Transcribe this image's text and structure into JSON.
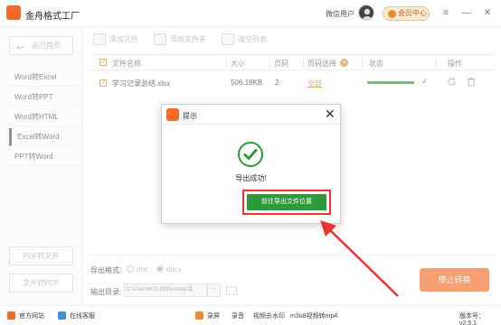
{
  "app": {
    "title": "金舟格式工厂",
    "user_label": "微信用户",
    "vip_label": "会员中心",
    "version": "版本号：v2.5.1"
  },
  "window_controls": {
    "menu": "≡",
    "minimize": "—",
    "close": "✕"
  },
  "sidebar": {
    "back_label": "返回首页",
    "items": [
      {
        "label": "Word转Excel"
      },
      {
        "label": "Word转PPT"
      },
      {
        "label": "Word转HTML"
      },
      {
        "label": "Excel转Word"
      },
      {
        "label": "PPT转Word"
      }
    ],
    "bottom_buttons": [
      {
        "label": "PDF转文件"
      },
      {
        "label": "文件转PDF"
      }
    ]
  },
  "toolbar": {
    "add_file": "添加文件",
    "add_folder": "添加文件夹",
    "clear_list": "清空列表"
  },
  "table": {
    "headers": {
      "name": "文件名称",
      "size": "大小",
      "pages": "页码",
      "page_select": "页码选择",
      "status": "状态",
      "actions": "操作"
    },
    "rows": [
      {
        "name": "学习记录总结.xlsx",
        "size": "506.18KB",
        "pages": "2",
        "page_select": "全部",
        "progress": 1.0
      }
    ]
  },
  "output": {
    "format_label": "导出格式:",
    "formats": [
      {
        "label": "doc",
        "selected": false
      },
      {
        "label": "docx",
        "selected": true
      }
    ],
    "dir_label": "输出目录:",
    "dir_value": "C:\\Users\\KYLIN\\Desktop\\金",
    "browse_label": "···",
    "stop_button": "停止转换"
  },
  "statusbar": {
    "items": [
      "官方网站",
      "在线客服",
      "录屏",
      "录音",
      "视频去水印",
      "m3u8视频转mp4"
    ]
  },
  "modal": {
    "title": "提示",
    "message": "导出成功!",
    "open_button": "前往导出文件位置",
    "close": "✕"
  },
  "colors": {
    "accent": "#f26b2a",
    "success": "#2e9a3a",
    "highlight": "#ee3333"
  }
}
